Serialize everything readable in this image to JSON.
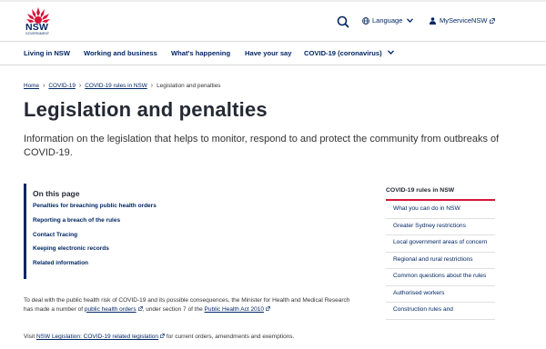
{
  "header": {
    "logo_text": "NSW",
    "logo_subtext": "GOVERNMENT",
    "language_label": "Language",
    "myservice_label": "MyServiceNSW"
  },
  "nav": {
    "items": [
      {
        "label": "Living in NSW"
      },
      {
        "label": "Working and business"
      },
      {
        "label": "What's happening"
      },
      {
        "label": "Have your say"
      },
      {
        "label": "COVID-19 (coronavirus)"
      }
    ]
  },
  "breadcrumb": {
    "items": [
      {
        "label": "Home"
      },
      {
        "label": "COVID-19"
      },
      {
        "label": "COVID-19 rules in NSW"
      }
    ],
    "current": "Legislation and penalties"
  },
  "page": {
    "title": "Legislation and penalties",
    "intro": "Information on the legislation that helps to monitor, respond to and protect the community from outbreaks of COVID-19."
  },
  "on_this_page": {
    "heading": "On this page",
    "links": [
      "Penalties for breaching public health orders",
      "Reporting a breach of the rules",
      "Contact Tracing",
      "Keeping electronic records",
      "Related information"
    ]
  },
  "body": {
    "p1_pre": "To deal with the public health risk of COVID-19 and its possible consequences, the Minister for Health and Medical Research has made a number of ",
    "p1_link1": "public health orders",
    "p1_mid": ", under section 7 of the ",
    "p1_link2": "Public Health Act 2010",
    "p2_pre": "Visit ",
    "p2_link": "NSW  Legislation: COVID-19 related legislation",
    "p2_post": " for current orders, amendments and exemptions."
  },
  "sidebar": {
    "heading": "COVID-19 rules in NSW",
    "items": [
      "What you can do in NSW",
      "Greater Sydney restrictions",
      "Local government areas of concern",
      "Regional and rural restrictions",
      "Common questions about the rules",
      "Authorised workers",
      "Construction rules and"
    ]
  },
  "colors": {
    "brand_navy": "#002664",
    "accent_red": "#d7153a"
  }
}
